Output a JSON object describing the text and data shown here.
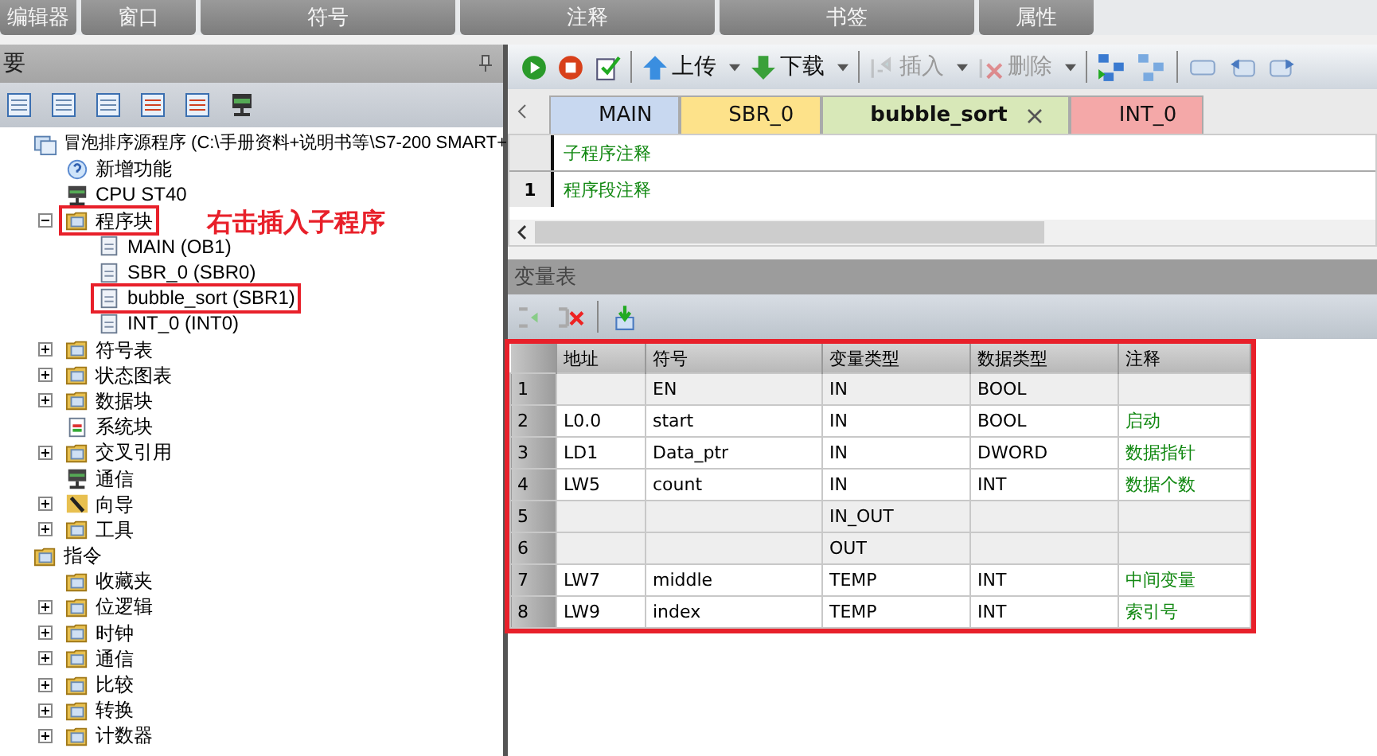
{
  "menu_groups": [
    "编辑器",
    "窗口",
    "符号",
    "注释",
    "书签",
    "属性"
  ],
  "project_panel": {
    "title": "要",
    "tree": [
      {
        "label": "冒泡排序源程序 (C:\\手册资料+说明书等\\S7-200 SMART+",
        "kind": "project",
        "highlighted": false,
        "children": [
          {
            "label": "新增功能",
            "kind": "help",
            "highlighted": false
          },
          {
            "label": "CPU ST40",
            "kind": "cpu",
            "highlighted": false
          },
          {
            "label": "程序块",
            "kind": "folder",
            "expanded": true,
            "highlighted": true,
            "children": [
              {
                "label": "MAIN (OB1)",
                "kind": "page",
                "highlighted": false
              },
              {
                "label": "SBR_0 (SBR0)",
                "kind": "page",
                "highlighted": false
              },
              {
                "label": "bubble_sort (SBR1)",
                "kind": "page",
                "highlighted": true
              },
              {
                "label": "INT_0 (INT0)",
                "kind": "page",
                "highlighted": false
              }
            ]
          },
          {
            "label": "符号表",
            "kind": "folder",
            "expanded": false,
            "highlighted": false
          },
          {
            "label": "状态图表",
            "kind": "folder",
            "expanded": false,
            "highlighted": false
          },
          {
            "label": "数据块",
            "kind": "folder",
            "expanded": false,
            "highlighted": false
          },
          {
            "label": "系统块",
            "kind": "sheet",
            "highlighted": false
          },
          {
            "label": "交叉引用",
            "kind": "folder",
            "expanded": false,
            "highlighted": false
          },
          {
            "label": "通信",
            "kind": "cpu",
            "highlighted": false
          },
          {
            "label": "向导",
            "kind": "wand",
            "expanded": false,
            "highlighted": false
          },
          {
            "label": "工具",
            "kind": "folder",
            "expanded": false,
            "highlighted": false
          }
        ]
      },
      {
        "label": "指令",
        "kind": "folder",
        "highlighted": false,
        "children": [
          {
            "label": "收藏夹",
            "kind": "folder",
            "highlighted": false
          },
          {
            "label": "位逻辑",
            "kind": "folder",
            "expanded": false,
            "highlighted": false
          },
          {
            "label": "时钟",
            "kind": "folder",
            "expanded": false,
            "highlighted": false
          },
          {
            "label": "通信",
            "kind": "folder",
            "expanded": false,
            "highlighted": false
          },
          {
            "label": "比较",
            "kind": "folder",
            "expanded": false,
            "highlighted": false
          },
          {
            "label": "转换",
            "kind": "folder",
            "expanded": false,
            "highlighted": false
          },
          {
            "label": "计数器",
            "kind": "folder",
            "expanded": false,
            "highlighted": false
          }
        ]
      }
    ]
  },
  "annotation": {
    "text": "右击插入子程序"
  },
  "toolbar": [
    {
      "kind": "run",
      "disabled": false
    },
    {
      "kind": "stop",
      "disabled": false
    },
    {
      "kind": "compile",
      "disabled": false
    },
    {
      "kind": "upload",
      "label": "上传",
      "disabled": false
    },
    {
      "kind": "download",
      "label": "下载",
      "disabled": false
    },
    {
      "kind": "insert",
      "label": "插入",
      "disabled": true
    },
    {
      "kind": "delete",
      "label": "删除",
      "disabled": true
    }
  ],
  "editor_tabs": [
    {
      "label": "MAIN",
      "color": "#c8d8f0",
      "selected": false
    },
    {
      "label": "SBR_0",
      "color": "#fde28a",
      "selected": false
    },
    {
      "label": "bubble_sort",
      "color": "#d8e8b8",
      "selected": true
    },
    {
      "label": "INT_0",
      "color": "#f4a8a8",
      "selected": false
    }
  ],
  "editor": {
    "subroutine_comment": "子程序注释",
    "network_number": "1",
    "network_comment": "程序段注释"
  },
  "variable_table": {
    "title": "变量表",
    "highlighted": true,
    "columns": [
      "地址",
      "符号",
      "变量类型",
      "数据类型",
      "注释"
    ],
    "rows": [
      {
        "number": "1",
        "address": "",
        "symbol": "EN",
        "var_type": "IN",
        "data_type": "BOOL",
        "comment": "",
        "greyed": true
      },
      {
        "number": "2",
        "address": "L0.0",
        "symbol": "start",
        "var_type": "IN",
        "data_type": "BOOL",
        "comment": "启动",
        "greyed": false
      },
      {
        "number": "3",
        "address": "LD1",
        "symbol": "Data_ptr",
        "var_type": "IN",
        "data_type": "DWORD",
        "comment": "数据指针",
        "greyed": false
      },
      {
        "number": "4",
        "address": "LW5",
        "symbol": "count",
        "var_type": "IN",
        "data_type": "INT",
        "comment": "数据个数",
        "greyed": false
      },
      {
        "number": "5",
        "address": "",
        "symbol": "",
        "var_type": "IN_OUT",
        "data_type": "",
        "comment": "",
        "greyed": true
      },
      {
        "number": "6",
        "address": "",
        "symbol": "",
        "var_type": "OUT",
        "data_type": "",
        "comment": "",
        "greyed": true
      },
      {
        "number": "7",
        "address": "LW7",
        "symbol": "middle",
        "var_type": "TEMP",
        "data_type": "INT",
        "comment": "中间变量",
        "greyed": false
      },
      {
        "number": "8",
        "address": "LW9",
        "symbol": "index",
        "var_type": "TEMP",
        "data_type": "INT",
        "comment": "索引号",
        "greyed": false
      }
    ]
  }
}
